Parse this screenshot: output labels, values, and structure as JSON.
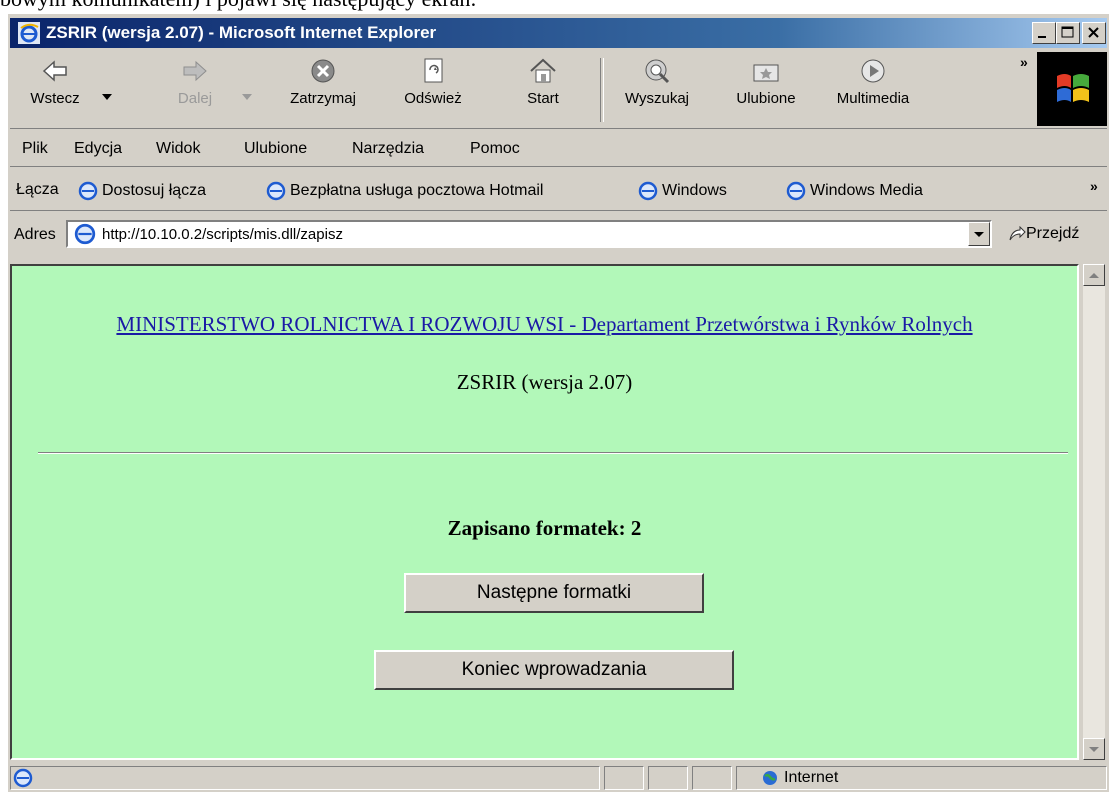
{
  "document_fragment": "bowym komunikatem) i pojawi się następujący ekran:",
  "window": {
    "title": "ZSRIR (wersja 2.07) - Microsoft Internet Explorer"
  },
  "toolbar": {
    "back": "Wstecz",
    "forward": "Dalej",
    "stop": "Zatrzymaj",
    "refresh": "Odśwież",
    "home": "Start",
    "search": "Wyszukaj",
    "favorites": "Ulubione",
    "media": "Multimedia",
    "more": "»"
  },
  "menu": {
    "file": "Plik",
    "edit": "Edycja",
    "view": "Widok",
    "favorites": "Ulubione",
    "tools": "Narzędzia",
    "help": "Pomoc"
  },
  "links_bar": {
    "label": "Łącza",
    "items": [
      "Dostosuj łącza",
      "Bezpłatna usługa pocztowa Hotmail",
      "Windows",
      "Windows Media"
    ],
    "more": "»"
  },
  "address_bar": {
    "label": "Adres",
    "url": "http://10.10.0.2/scripts/mis.dll/zapisz",
    "go": "Przejdź"
  },
  "page": {
    "header_link": "MINISTERSTWO ROLNICTWA I ROZWOJU WSI - Departament Przetwórstwa i Rynków Rolnych",
    "version": "ZSRIR (wersja 2.07)",
    "saved_message": "Zapisano formatek: 2",
    "next_button": "Następne formatki",
    "end_button": "Koniec wprowadzania"
  },
  "status_bar": {
    "zone": "Internet"
  }
}
